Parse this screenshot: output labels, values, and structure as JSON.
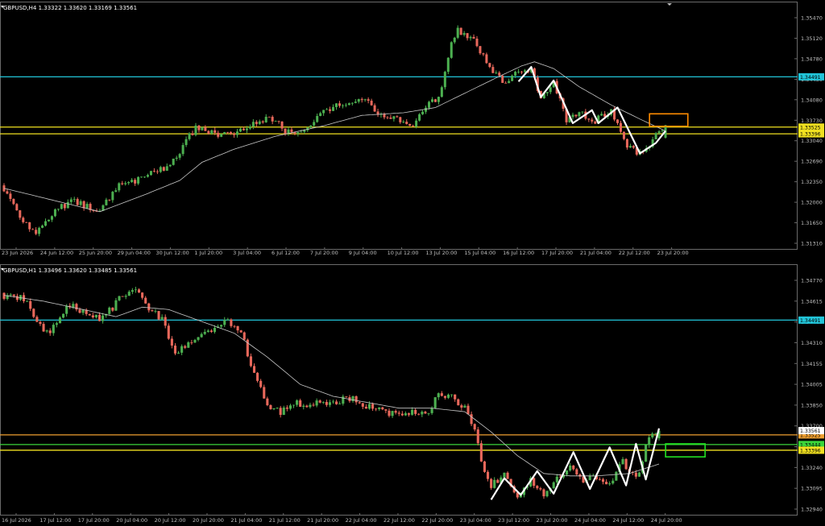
{
  "colors": {
    "background": "#000000",
    "bull": "#4caf50",
    "bear": "#e8685b",
    "ma": "#c8c8c8",
    "zigzag": "#ffffff",
    "axis_text": "#c0c0c0",
    "frame": "#6a6a6a",
    "cyan_level": "#21c4d8",
    "yellow_level": "#f0e020",
    "orange_level": "#f0a030",
    "green_level": "#3ad63a",
    "orange_box": "#ff8c00",
    "green_box": "#22e022"
  },
  "panels": [
    {
      "header": "GBPUSD,H4  1.33322 1.33620 1.33169 1.33561",
      "y_ticks": [
        "1.35470",
        "1.35120",
        "1.34780",
        "1.34430",
        "1.34080",
        "1.33730",
        "1.33040",
        "1.32690",
        "1.32350",
        "1.32000",
        "1.31650",
        "1.31310"
      ],
      "x_ticks": [
        "23 Jun 2026",
        "24 Jun 12:00",
        "25 Jun 20:00",
        "29 Jun 04:00",
        "30 Jun 12:00",
        "1 Jul 20:00",
        "3 Jul 04:00",
        "6 Jul 12:00",
        "7 Jul 20:00",
        "9 Jul 04:00",
        "10 Jul 12:00",
        "13 Jul 20:00",
        "15 Jul 04:00",
        "16 Jul 12:00",
        "17 Jul 20:00",
        "21 Jul 04:00",
        "22 Jul 12:00",
        "23 Jul 20:00"
      ],
      "levels": [
        {
          "name": "cyan-level",
          "price_label": "1.34491",
          "color": "#21c4d8"
        },
        {
          "name": "yellow-level-upper",
          "price_label": "1.33525",
          "color": "#f0e020"
        },
        {
          "name": "yellow-level-lower",
          "price_label": "1.33396",
          "color": "#f0e020"
        }
      ]
    },
    {
      "header": "GBPUSD,H1  1.33496 1.33620 1.33485 1.33561",
      "y_ticks": [
        "1.34770",
        "1.34615",
        "1.34460",
        "1.34310",
        "1.34155",
        "1.34005",
        "1.33850",
        "1.33700",
        "1.33545",
        "1.33240",
        "1.33095",
        "1.32940"
      ],
      "x_ticks": [
        "16 Jul 2026",
        "17 Jul 12:00",
        "17 Jul 20:00",
        "20 Jul 04:00",
        "20 Jul 12:00",
        "20 Jul 20:00",
        "21 Jul 04:00",
        "21 Jul 12:00",
        "21 Jul 20:00",
        "22 Jul 04:00",
        "22 Jul 12:00",
        "22 Jul 20:00",
        "23 Jul 04:00",
        "23 Jul 12:00",
        "23 Jul 20:00",
        "24 Jul 04:00",
        "24 Jul 12:00",
        "24 Jul 20:00"
      ],
      "levels": [
        {
          "name": "cyan-level",
          "price_label": "1.34491",
          "color": "#21c4d8"
        },
        {
          "name": "orange-level",
          "price_label": "1.33525",
          "color": "#f0a030"
        },
        {
          "name": "green-level",
          "price_label": "1.33444",
          "color": "#3ad63a"
        },
        {
          "name": "yellow-level",
          "price_label": "1.33396",
          "color": "#f0e020"
        }
      ],
      "bid_label": "1.33561"
    }
  ],
  "chart_data": [
    {
      "type": "candlestick",
      "title": "GBPUSD,H4",
      "ohlc_last": {
        "open": 1.33322,
        "high": 1.3362,
        "low": 1.33169,
        "close": 1.33561
      },
      "ylim": [
        1.312,
        1.3575
      ],
      "horizontal_levels": [
        1.34491,
        1.33525,
        1.33396
      ],
      "close_path": [
        {
          "i": 0,
          "c": 1.3236
        },
        {
          "i": 5,
          "c": 1.318
        },
        {
          "i": 10,
          "c": 1.315
        },
        {
          "i": 16,
          "c": 1.3195
        },
        {
          "i": 22,
          "c": 1.321
        },
        {
          "i": 30,
          "c": 1.319
        },
        {
          "i": 36,
          "c": 1.324
        },
        {
          "i": 42,
          "c": 1.325
        },
        {
          "i": 48,
          "c": 1.3268
        },
        {
          "i": 54,
          "c": 1.329
        },
        {
          "i": 58,
          "c": 1.3335
        },
        {
          "i": 60,
          "c": 1.335
        },
        {
          "i": 66,
          "c": 1.334
        },
        {
          "i": 72,
          "c": 1.3335
        },
        {
          "i": 78,
          "c": 1.336
        },
        {
          "i": 84,
          "c": 1.337
        },
        {
          "i": 88,
          "c": 1.3345
        },
        {
          "i": 94,
          "c": 1.3345
        },
        {
          "i": 100,
          "c": 1.3385
        },
        {
          "i": 106,
          "c": 1.34
        },
        {
          "i": 112,
          "c": 1.341
        },
        {
          "i": 118,
          "c": 1.3375
        },
        {
          "i": 124,
          "c": 1.3365
        },
        {
          "i": 128,
          "c": 1.3352
        },
        {
          "i": 132,
          "c": 1.339
        },
        {
          "i": 136,
          "c": 1.341
        },
        {
          "i": 140,
          "c": 1.351
        },
        {
          "i": 142,
          "c": 1.354
        },
        {
          "i": 147,
          "c": 1.352
        },
        {
          "i": 151,
          "c": 1.3475
        },
        {
          "i": 156,
          "c": 1.344
        },
        {
          "i": 161,
          "c": 1.3455
        },
        {
          "i": 165,
          "c": 1.3465
        },
        {
          "i": 168,
          "c": 1.341
        },
        {
          "i": 172,
          "c": 1.344
        },
        {
          "i": 176,
          "c": 1.3365
        },
        {
          "i": 180,
          "c": 1.3385
        },
        {
          "i": 184,
          "c": 1.336
        },
        {
          "i": 190,
          "c": 1.3385
        },
        {
          "i": 195,
          "c": 1.332
        },
        {
          "i": 199,
          "c": 1.33
        },
        {
          "i": 202,
          "c": 1.332
        },
        {
          "i": 207,
          "c": 1.3356
        }
      ],
      "ma_path": [
        {
          "i": 0,
          "v": 1.3235
        },
        {
          "i": 20,
          "v": 1.3205
        },
        {
          "i": 30,
          "v": 1.319
        },
        {
          "i": 45,
          "v": 1.3225
        },
        {
          "i": 55,
          "v": 1.325
        },
        {
          "i": 62,
          "v": 1.3285
        },
        {
          "i": 72,
          "v": 1.331
        },
        {
          "i": 85,
          "v": 1.3335
        },
        {
          "i": 100,
          "v": 1.3355
        },
        {
          "i": 112,
          "v": 1.3375
        },
        {
          "i": 125,
          "v": 1.338
        },
        {
          "i": 135,
          "v": 1.339
        },
        {
          "i": 145,
          "v": 1.342
        },
        {
          "i": 155,
          "v": 1.345
        },
        {
          "i": 162,
          "v": 1.347
        },
        {
          "i": 166,
          "v": 1.3478
        },
        {
          "i": 172,
          "v": 1.3465
        },
        {
          "i": 180,
          "v": 1.343
        },
        {
          "i": 190,
          "v": 1.3395
        },
        {
          "i": 200,
          "v": 1.3365
        },
        {
          "i": 207,
          "v": 1.3345
        }
      ],
      "zigzag": [
        {
          "i": 161,
          "v": 1.344
        },
        {
          "i": 165,
          "v": 1.3468
        },
        {
          "i": 168,
          "v": 1.341
        },
        {
          "i": 172,
          "v": 1.3442
        },
        {
          "i": 178,
          "v": 1.336
        },
        {
          "i": 184,
          "v": 1.3385
        },
        {
          "i": 186,
          "v": 1.336
        },
        {
          "i": 192,
          "v": 1.339
        },
        {
          "i": 199,
          "v": 1.3302
        },
        {
          "i": 204,
          "v": 1.3322
        },
        {
          "i": 207,
          "v": 1.3345
        }
      ],
      "rectangle": {
        "i_start": 202,
        "i_end": 214,
        "price_top": 1.3378,
        "price_bottom": 1.3354
      }
    },
    {
      "type": "candlestick",
      "title": "GBPUSD,H1",
      "ohlc_last": {
        "open": 1.33496,
        "high": 1.3362,
        "low": 1.33485,
        "close": 1.33561
      },
      "ylim": [
        1.3286,
        1.3488
      ],
      "horizontal_levels": [
        1.34491,
        1.33525,
        1.33444,
        1.33396
      ],
      "close_path": [
        {
          "i": 0,
          "c": 1.347
        },
        {
          "i": 6,
          "c": 1.3468
        },
        {
          "i": 10,
          "c": 1.3445
        },
        {
          "i": 14,
          "c": 1.344
        },
        {
          "i": 20,
          "c": 1.3462
        },
        {
          "i": 25,
          "c": 1.3455
        },
        {
          "i": 30,
          "c": 1.345
        },
        {
          "i": 36,
          "c": 1.347
        },
        {
          "i": 40,
          "c": 1.3475
        },
        {
          "i": 44,
          "c": 1.346
        },
        {
          "i": 48,
          "c": 1.345
        },
        {
          "i": 52,
          "c": 1.342
        },
        {
          "i": 56,
          "c": 1.343
        },
        {
          "i": 60,
          "c": 1.3438
        },
        {
          "i": 64,
          "c": 1.344
        },
        {
          "i": 68,
          "c": 1.345
        },
        {
          "i": 72,
          "c": 1.3438
        },
        {
          "i": 76,
          "c": 1.3405
        },
        {
          "i": 80,
          "c": 1.3375
        },
        {
          "i": 84,
          "c": 1.3372
        },
        {
          "i": 88,
          "c": 1.338
        },
        {
          "i": 92,
          "c": 1.3378
        },
        {
          "i": 96,
          "c": 1.3382
        },
        {
          "i": 100,
          "c": 1.3378
        },
        {
          "i": 104,
          "c": 1.3385
        },
        {
          "i": 108,
          "c": 1.338
        },
        {
          "i": 112,
          "c": 1.3375
        },
        {
          "i": 116,
          "c": 1.3372
        },
        {
          "i": 120,
          "c": 1.337
        },
        {
          "i": 124,
          "c": 1.3372
        },
        {
          "i": 128,
          "c": 1.337
        },
        {
          "i": 132,
          "c": 1.3385
        },
        {
          "i": 136,
          "c": 1.3385
        },
        {
          "i": 140,
          "c": 1.3375
        },
        {
          "i": 143,
          "c": 1.3355
        },
        {
          "i": 145,
          "c": 1.333
        },
        {
          "i": 148,
          "c": 1.331
        },
        {
          "i": 152,
          "c": 1.3318
        },
        {
          "i": 156,
          "c": 1.33
        },
        {
          "i": 160,
          "c": 1.3315
        },
        {
          "i": 164,
          "c": 1.3302
        },
        {
          "i": 168,
          "c": 1.3318
        },
        {
          "i": 172,
          "c": 1.3325
        },
        {
          "i": 176,
          "c": 1.3312
        },
        {
          "i": 180,
          "c": 1.3318
        },
        {
          "i": 184,
          "c": 1.331
        },
        {
          "i": 188,
          "c": 1.333
        },
        {
          "i": 192,
          "c": 1.3315
        },
        {
          "i": 196,
          "c": 1.335
        },
        {
          "i": 199,
          "c": 1.3356
        }
      ],
      "ma_path": [
        {
          "i": 0,
          "v": 1.347
        },
        {
          "i": 12,
          "v": 1.3465
        },
        {
          "i": 24,
          "v": 1.3458
        },
        {
          "i": 34,
          "v": 1.3452
        },
        {
          "i": 42,
          "v": 1.346
        },
        {
          "i": 50,
          "v": 1.3458
        },
        {
          "i": 60,
          "v": 1.3448
        },
        {
          "i": 70,
          "v": 1.3438
        },
        {
          "i": 80,
          "v": 1.3418
        },
        {
          "i": 90,
          "v": 1.3395
        },
        {
          "i": 100,
          "v": 1.3385
        },
        {
          "i": 110,
          "v": 1.338
        },
        {
          "i": 120,
          "v": 1.3375
        },
        {
          "i": 130,
          "v": 1.3375
        },
        {
          "i": 140,
          "v": 1.3372
        },
        {
          "i": 148,
          "v": 1.3355
        },
        {
          "i": 156,
          "v": 1.3335
        },
        {
          "i": 164,
          "v": 1.332
        },
        {
          "i": 172,
          "v": 1.3318
        },
        {
          "i": 180,
          "v": 1.3318
        },
        {
          "i": 190,
          "v": 1.332
        },
        {
          "i": 199,
          "v": 1.3328
        }
      ],
      "zigzag": [
        {
          "i": 148,
          "v": 1.3298
        },
        {
          "i": 152,
          "v": 1.3316
        },
        {
          "i": 157,
          "v": 1.3302
        },
        {
          "i": 162,
          "v": 1.3322
        },
        {
          "i": 167,
          "v": 1.3303
        },
        {
          "i": 173,
          "v": 1.3338
        },
        {
          "i": 178,
          "v": 1.3307
        },
        {
          "i": 184,
          "v": 1.3342
        },
        {
          "i": 189,
          "v": 1.331
        },
        {
          "i": 192,
          "v": 1.3345
        },
        {
          "i": 195,
          "v": 1.3315
        },
        {
          "i": 199,
          "v": 1.3358
        }
      ],
      "rectangle": {
        "i_start": 201,
        "i_end": 213,
        "price_top": 1.3345,
        "price_bottom": 1.3334
      }
    }
  ]
}
